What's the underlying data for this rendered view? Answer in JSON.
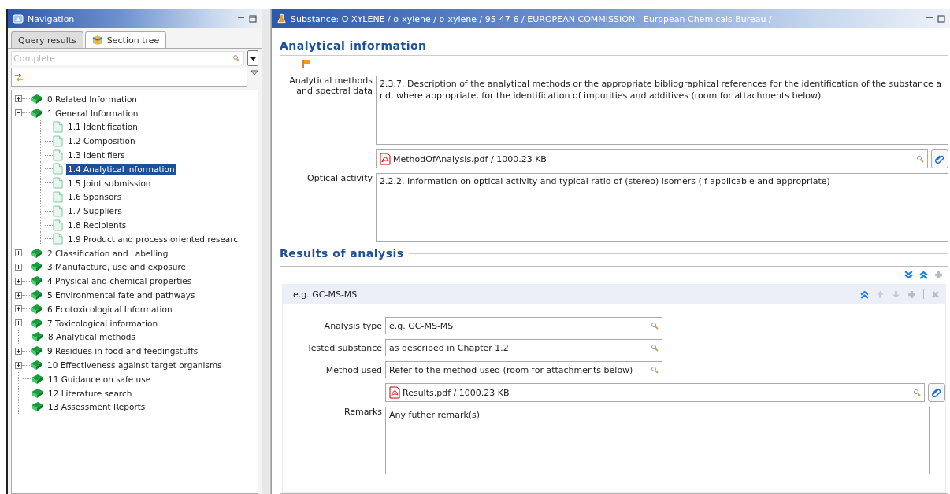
{
  "navigation": {
    "title": "Navigation",
    "tabs": [
      {
        "label": "Query results",
        "selected": false
      },
      {
        "label": "Section tree",
        "selected": true
      }
    ],
    "filter": {
      "placeholder": "Complete"
    },
    "tree": [
      {
        "label": "0 Related Information",
        "kind": "book",
        "expanded": false,
        "selected": false
      },
      {
        "label": "1 General Information",
        "kind": "book",
        "expanded": true,
        "selected": false,
        "children": [
          {
            "label": "1.1 Identification",
            "kind": "page",
            "selected": false
          },
          {
            "label": "1.2 Composition",
            "kind": "page",
            "selected": false
          },
          {
            "label": "1.3 Identifiers",
            "kind": "page",
            "selected": false
          },
          {
            "label": "1.4 Analytical information",
            "kind": "page",
            "selected": true
          },
          {
            "label": "1.5 Joint submission",
            "kind": "page",
            "selected": false
          },
          {
            "label": "1.6 Sponsors",
            "kind": "page",
            "selected": false
          },
          {
            "label": "1.7 Suppliers",
            "kind": "page",
            "selected": false
          },
          {
            "label": "1.8 Recipients",
            "kind": "page",
            "selected": false
          },
          {
            "label": "1.9 Product and process oriented researc",
            "kind": "page",
            "selected": false
          }
        ]
      },
      {
        "label": "2 Classification and Labelling",
        "kind": "book",
        "expanded": false,
        "selected": false
      },
      {
        "label": "3 Manufacture, use and exposure",
        "kind": "book",
        "expanded": false,
        "selected": false
      },
      {
        "label": "4 Physical and chemical properties",
        "kind": "book",
        "expanded": false,
        "selected": false
      },
      {
        "label": "5 Environmental fate and pathways",
        "kind": "book",
        "expanded": false,
        "selected": false
      },
      {
        "label": "6 Ecotoxicological Information",
        "kind": "book",
        "expanded": false,
        "selected": false
      },
      {
        "label": "7 Toxicological information",
        "kind": "book",
        "expanded": false,
        "selected": false
      },
      {
        "label": "8 Analytical methods",
        "kind": "book",
        "selected": false
      },
      {
        "label": "9 Residues in food and feedingstuffs",
        "kind": "book",
        "expanded": false,
        "selected": false
      },
      {
        "label": "10 Effectiveness against target organisms",
        "kind": "book",
        "expanded": false,
        "selected": false
      },
      {
        "label": "11 Guidance on safe use",
        "kind": "book",
        "selected": false
      },
      {
        "label": "12 Literature search",
        "kind": "book",
        "selected": false
      },
      {
        "label": "13 Assessment Reports",
        "kind": "book",
        "selected": false
      }
    ]
  },
  "editor": {
    "title": "Substance: O-XYLENE / o-xylene / o-xylene / 95-47-6 / EUROPEAN COMMISSION - European Chemicals Bureau /",
    "sections": [
      {
        "title": "Analytical information",
        "fields": [
          {
            "kind": "textarea",
            "label": "Analytical methods and spectral data",
            "value": "2.3.7. Description of the analytical methods or the appropriate bibliographical references for the identification of the substance and, where appropriate, for the identification of impurities and additives (room for attachments below)."
          },
          {
            "kind": "attachment",
            "value": "MethodOfAnalysis.pdf / 1000.23 KB"
          },
          {
            "kind": "textarea",
            "label": "Optical activity",
            "value": "2.2.2. Information on optical activity and typical ratio of (stereo) isomers (if applicable and appropriate)"
          }
        ]
      },
      {
        "title": "Results of analysis",
        "block": {
          "title": "e.g. GC-MS-MS",
          "fields": [
            {
              "kind": "picklist",
              "label": "Analysis type",
              "value": "e.g. GC-MS-MS"
            },
            {
              "kind": "picklist",
              "label": "Tested substance",
              "value": "as described in Chapter 1.2"
            },
            {
              "kind": "picklist",
              "label": "Method used",
              "value": "Refer to the method used (room for attachments below)"
            },
            {
              "kind": "attachment",
              "value": "Results.pdf / 1000.23 KB"
            },
            {
              "kind": "textarea",
              "label": "Remarks",
              "value": "Any futher remark(s)"
            }
          ]
        }
      }
    ]
  }
}
